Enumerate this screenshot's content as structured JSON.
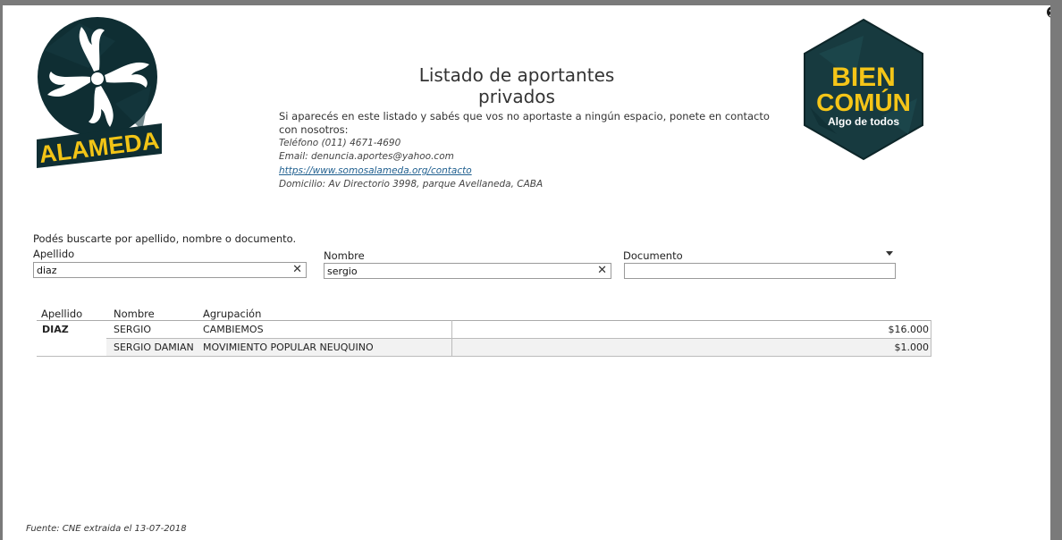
{
  "header": {
    "title": "Listado de aportantes privados",
    "info_text": "Si aparecés en este listado y sabés que vos no aportaste a ningún espacio, ponete en contacto con nosotros:",
    "phone": "Teléfono (011) 4671-4690",
    "email": "Email: denuncia.aportes@yahoo.com",
    "link": "https://www.somosalameda.org/contacto",
    "address": "Domicilio: Av Directorio 3998, parque Avellaneda, CABA"
  },
  "logos": {
    "alameda_text": "ALAMEDA",
    "bien_line1": "BIEN",
    "bien_line2": "COMÚN",
    "bien_line3": "Algo de todos"
  },
  "search": {
    "hint": "Podés buscarte por apellido, nombre o documento.",
    "apellido_label": "Apellido",
    "apellido_value": "diaz",
    "nombre_label": "Nombre",
    "nombre_value": "sergio",
    "documento_label": "Documento",
    "documento_value": ""
  },
  "table": {
    "headers": [
      "Apellido",
      "Nombre",
      "Agrupación"
    ],
    "group_apellido": "DIAZ",
    "rows": [
      {
        "nombre": "SERGIO",
        "agrupacion": "CAMBIEMOS",
        "monto": "$16.000"
      },
      {
        "nombre": "SERGIO DAMIAN",
        "agrupacion": "MOVIMIENTO POPULAR NEUQUINO",
        "monto": "$1.000"
      }
    ]
  },
  "footer": {
    "source": "Fuente: CNE extraida el 13-07-2018"
  },
  "icons": {
    "close": "close-icon",
    "clear": "clear-icon",
    "dropdown": "chevron-down-icon"
  },
  "colors": {
    "alameda_dark": "#0f2e33",
    "alameda_yellow": "#f2c416",
    "bien_dark": "#173a3f",
    "bien_yellow": "#f5c518",
    "link": "#1f5f8f"
  }
}
